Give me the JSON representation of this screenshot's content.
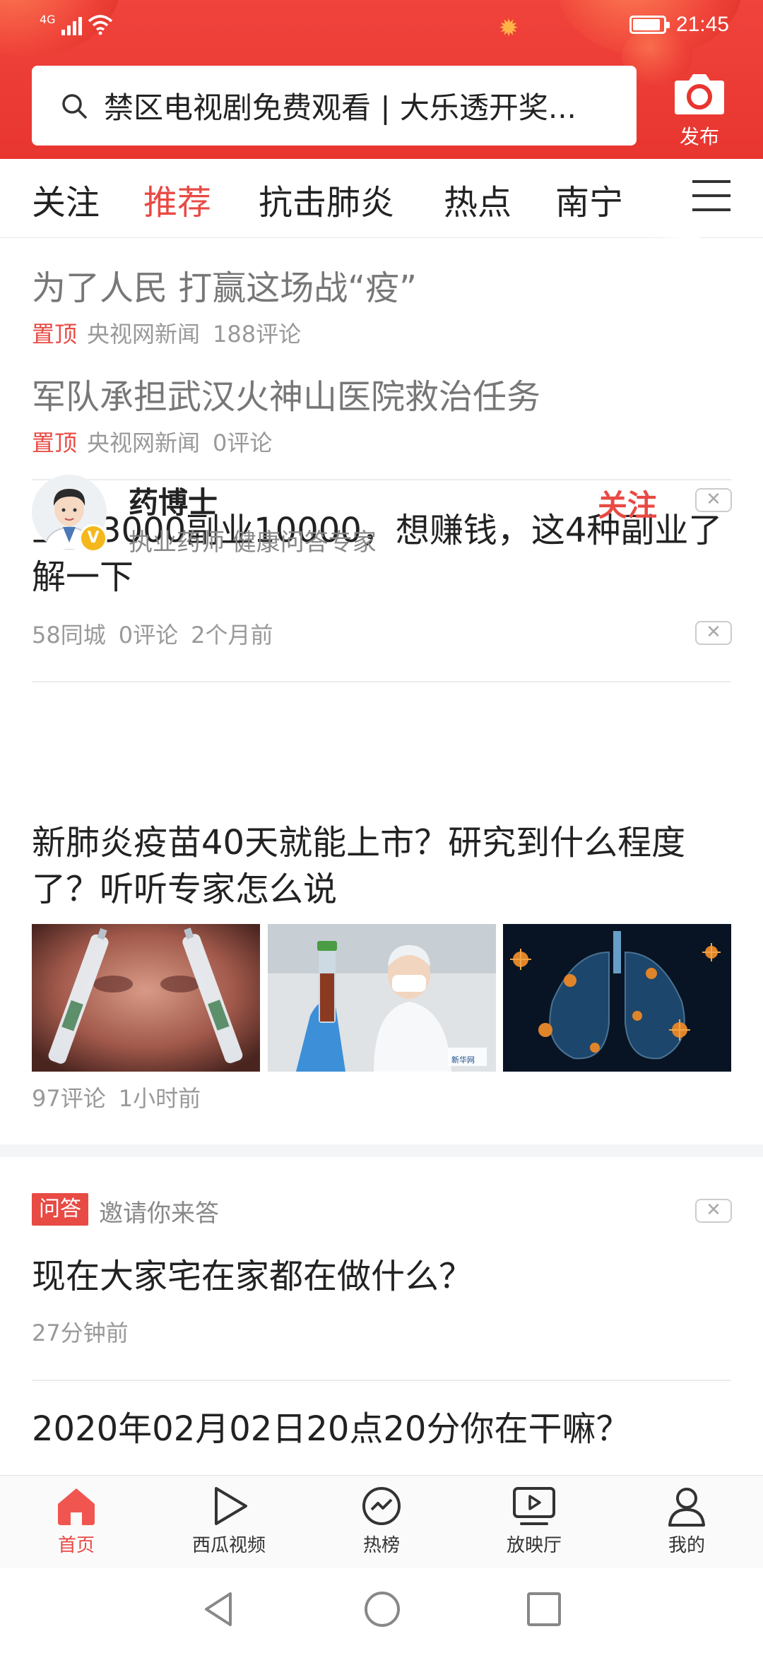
{
  "status_bar": {
    "network": "4G",
    "time": "21:45",
    "battery_level": 0.9
  },
  "header": {
    "search_text": "禁区电视剧免费观看 | 大乐透开奖...",
    "publish_label": "发布"
  },
  "tabs": {
    "items": [
      "关注",
      "推荐",
      "抗击肺炎",
      "热点",
      "南宁"
    ],
    "active": "推荐"
  },
  "pinned": [
    {
      "title": "为了人民 打赢这场战“疫”",
      "tag": "置顶",
      "source": "央视网新闻",
      "comments": "188评论"
    },
    {
      "title": "军队承担武汉火神山医院救治任务",
      "tag": "置顶",
      "source": "央视网新闻",
      "comments": "0评论"
    }
  ],
  "article1": {
    "title": "工资3000副业10000，想赚钱，这4种副业了解一下",
    "source": "58同城",
    "comments": "0评论",
    "time": "2个月前"
  },
  "article2": {
    "author": "药博士",
    "author_desc": "执业药师 健康问答专家",
    "follow_label": "关注",
    "title": "新肺炎疫苗40天就能上市？研究到什么程度了？听听专家怎么说",
    "comments": "97评论",
    "time": "1小时前",
    "image_caption": "新华网"
  },
  "qa": {
    "tag": "问答",
    "invite": "邀请你来答",
    "question": "现在大家宅在家都在做什么？",
    "time": "27分钟前"
  },
  "article3": {
    "title": "2020年02月02日20点20分你在干嘛？"
  },
  "bottom_nav": {
    "items": [
      {
        "label": "首页",
        "icon": "home-icon"
      },
      {
        "label": "西瓜视频",
        "icon": "play-icon"
      },
      {
        "label": "热榜",
        "icon": "trending-icon"
      },
      {
        "label": "放映厅",
        "icon": "screen-play-icon"
      },
      {
        "label": "我的",
        "icon": "person-icon"
      }
    ],
    "active": "首页"
  },
  "colors": {
    "brand_red": "#e84a44",
    "header_red": "#f0433c"
  }
}
